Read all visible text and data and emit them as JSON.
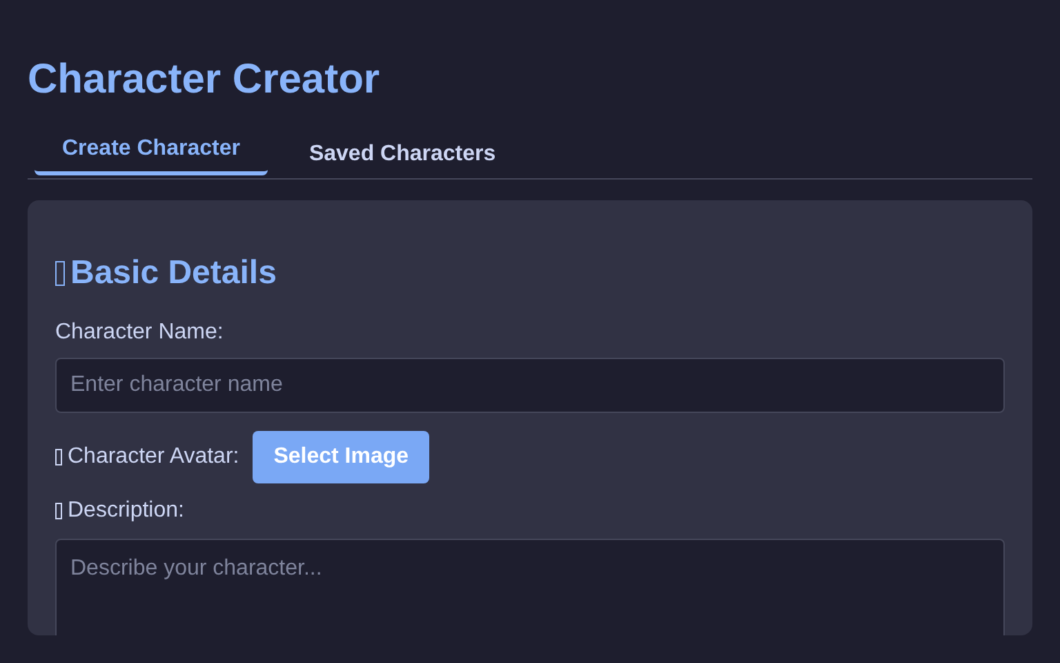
{
  "title": "Character Creator",
  "tabs": [
    {
      "label": "Create Character",
      "selected": true
    },
    {
      "label": "Saved Characters",
      "selected": false
    }
  ],
  "section": {
    "heading": "Basic Details",
    "name_field": {
      "label": "Character Name:",
      "placeholder": "Enter character name"
    },
    "avatar": {
      "label": "Character Avatar:",
      "button": "Select Image"
    },
    "description": {
      "label": "Description:",
      "placeholder": "Describe your character..."
    }
  }
}
